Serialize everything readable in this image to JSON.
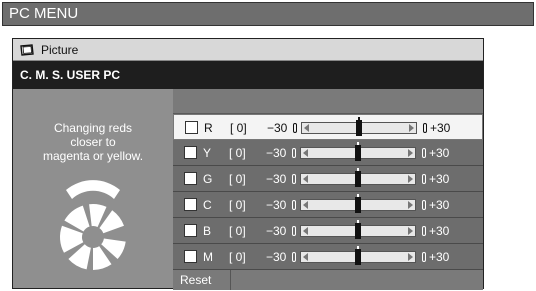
{
  "title_bar": {
    "title": "PC MENU"
  },
  "tab": {
    "label": "Picture",
    "icon": "picture-icon"
  },
  "section": {
    "title": "C. M. S. USER PC"
  },
  "left_panel": {
    "description": [
      "Changing reds",
      "closer to",
      "magenta or yellow."
    ],
    "icon": "color-wheel-icon"
  },
  "slider_min_label": "−30",
  "slider_max_label": "+30",
  "colors": {
    "window_bg": "#8a8a8a",
    "selected_row_bg": "#f4f4f4",
    "row_bg": "#6d6d6d",
    "section_bg": "#1e1e1e"
  },
  "rows": [
    {
      "letter": "R",
      "value_text": "[ 0]",
      "value": 0,
      "selected": true
    },
    {
      "letter": "Y",
      "value_text": "[ 0]",
      "value": 0,
      "selected": false
    },
    {
      "letter": "G",
      "value_text": "[ 0]",
      "value": 0,
      "selected": false
    },
    {
      "letter": "C",
      "value_text": "[ 0]",
      "value": 0,
      "selected": false
    },
    {
      "letter": "B",
      "value_text": "[ 0]",
      "value": 0,
      "selected": false
    },
    {
      "letter": "M",
      "value_text": "[ 0]",
      "value": 0,
      "selected": false
    }
  ],
  "reset": {
    "label": "Reset"
  }
}
